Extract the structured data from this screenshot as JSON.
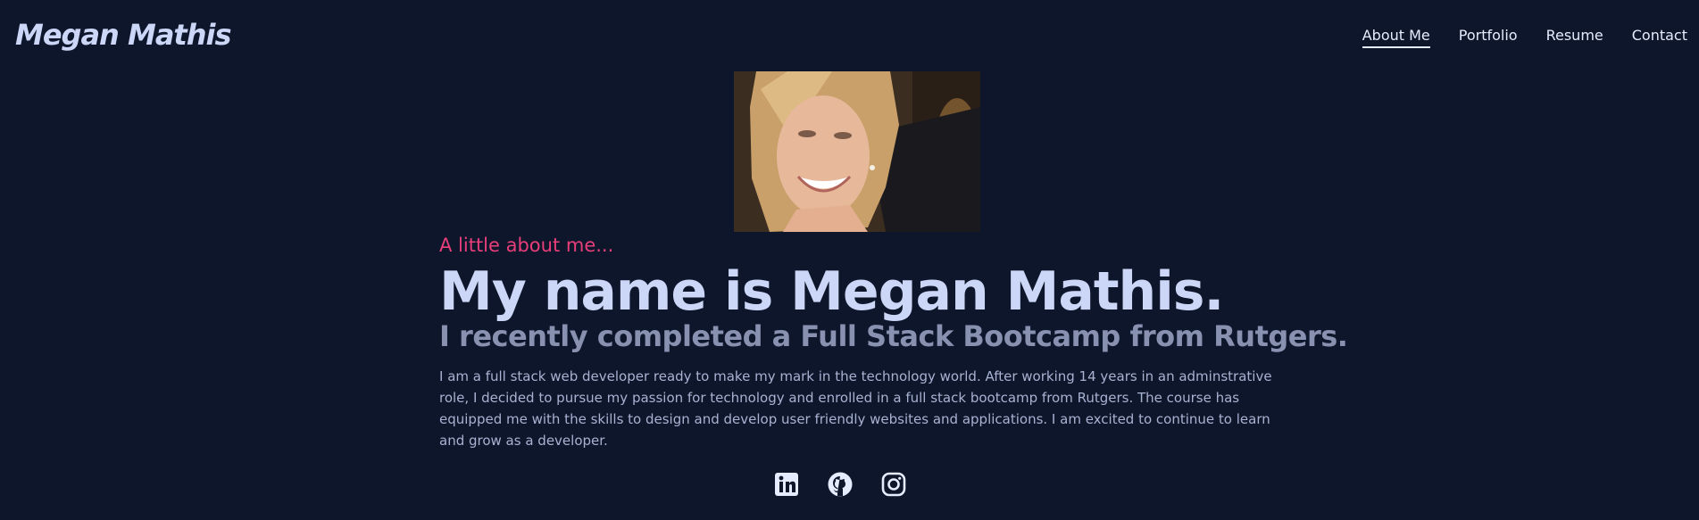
{
  "header": {
    "logo": "Megan Mathis",
    "nav": [
      {
        "label": "About Me",
        "active": true
      },
      {
        "label": "Portfolio",
        "active": false
      },
      {
        "label": "Resume",
        "active": false
      },
      {
        "label": "Contact",
        "active": false
      }
    ]
  },
  "about": {
    "intro": "A little about me...",
    "name": "My name is Megan Mathis.",
    "tagline": "I recently completed a Full Stack Bootcamp from Rutgers.",
    "bio": "I am a full stack web developer ready to make my mark in the technology world. After working 14 years in an adminstrative role, I decided to pursue my passion for technology and enrolled in a full stack bootcamp from Rutgers. The course has equipped me with the skills to design and develop user friendly websites and applications. I am excited to continue to learn and grow as a developer."
  },
  "socials": [
    {
      "icon": "linkedin-icon"
    },
    {
      "icon": "github-icon"
    },
    {
      "icon": "instagram-icon"
    }
  ],
  "colors": {
    "background": "#0e162b",
    "accent": "#e83e7a",
    "heading": "#ccd6f6",
    "subheading": "#8892b0",
    "body_text": "#a8b2d1"
  }
}
